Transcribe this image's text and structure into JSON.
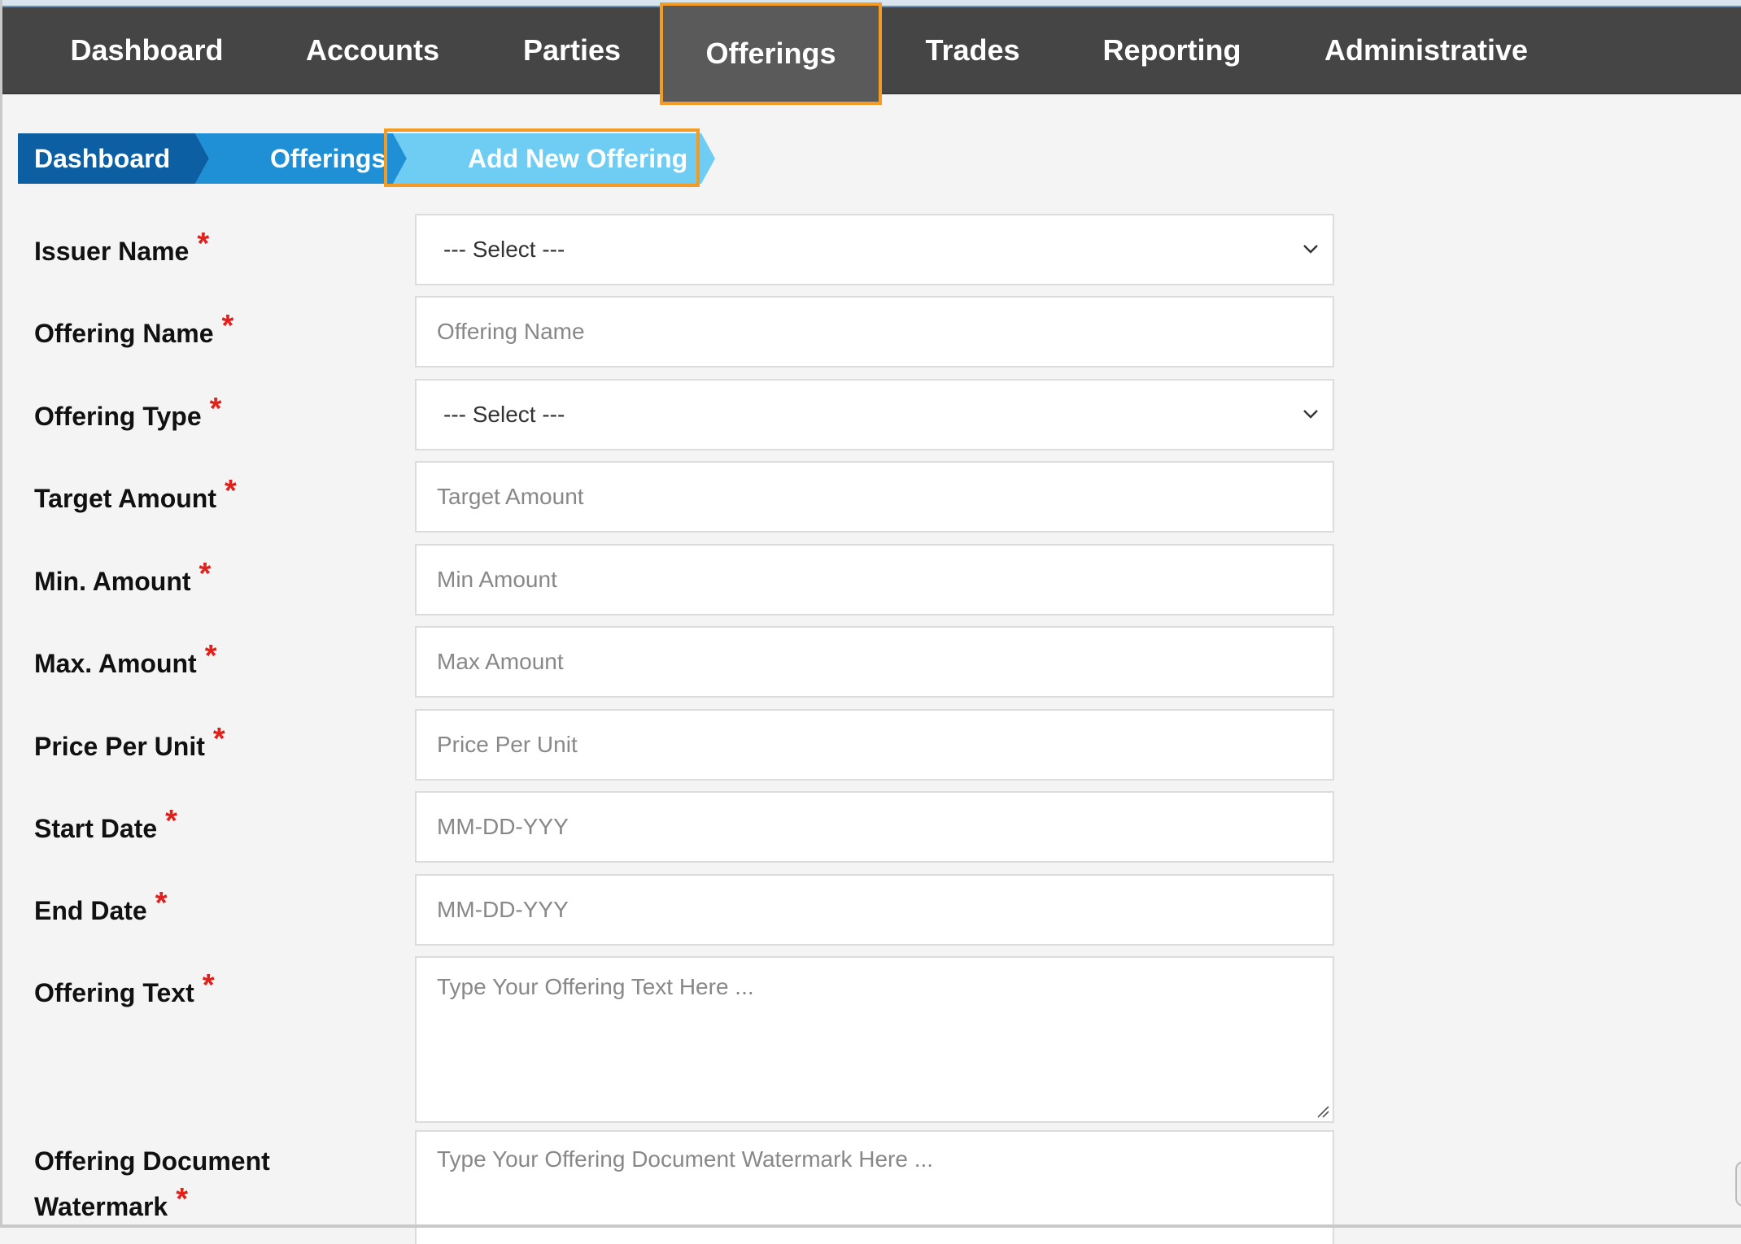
{
  "nav": {
    "items": [
      {
        "label": "Dashboard"
      },
      {
        "label": "Accounts"
      },
      {
        "label": "Parties"
      },
      {
        "label": "Offerings"
      },
      {
        "label": "Trades"
      },
      {
        "label": "Reporting"
      },
      {
        "label": "Administrative"
      }
    ],
    "active": "Offerings"
  },
  "breadcrumb": [
    "Dashboard",
    "Offerings",
    "Add New Offering"
  ],
  "form": {
    "required_mark": "*",
    "fields": [
      {
        "label": "Issuer Name",
        "value": "--- Select ---"
      },
      {
        "label": "Offering Name",
        "placeholder": "Offering Name"
      },
      {
        "label": "Offering Type",
        "value": "--- Select ---"
      },
      {
        "label": "Target Amount",
        "placeholder": "Target Amount"
      },
      {
        "label": "Min. Amount",
        "placeholder": "Min Amount"
      },
      {
        "label": "Max. Amount",
        "placeholder": "Max Amount"
      },
      {
        "label": "Price Per Unit",
        "placeholder": "Price Per Unit"
      },
      {
        "label": "Start Date",
        "placeholder": "MM-DD-YYY"
      },
      {
        "label": "End Date",
        "placeholder": "MM-DD-YYY"
      },
      {
        "label": "Offering Text",
        "placeholder": "Type Your Offering Text Here ..."
      },
      {
        "label_line1": "Offering Document",
        "label_line2": "Watermark",
        "placeholder": "Type Your Offering Document Watermark Here ..."
      }
    ]
  },
  "colors": {
    "nav_bg": "#454545",
    "highlight": "#f59a23",
    "crumb_dark": "#0c5fa3",
    "crumb_mid": "#1f8fd6",
    "crumb_light": "#6fcdf3",
    "required": "#e0201b"
  },
  "icons": {
    "select_arrow": "chevron-down-icon",
    "textarea_resize": "resize-grip-icon"
  }
}
